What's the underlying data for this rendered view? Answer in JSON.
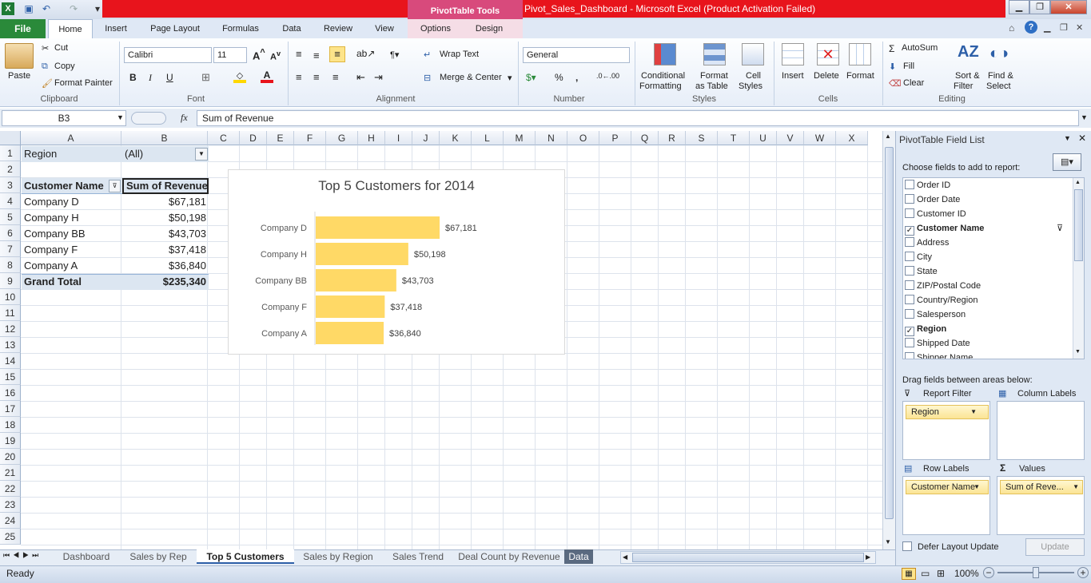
{
  "title": {
    "context_tab": "PivotTable Tools",
    "window_title": "Pivot_Sales_Dashboard - Microsoft Excel (Product Activation Failed)"
  },
  "tabs": [
    "File",
    "Home",
    "Insert",
    "Page Layout",
    "Formulas",
    "Data",
    "Review",
    "View",
    "Options",
    "Design"
  ],
  "ribbon": {
    "clipboard": {
      "paste": "Paste",
      "cut": "Cut",
      "copy": "Copy",
      "format_painter": "Format Painter",
      "label": "Clipboard"
    },
    "font": {
      "name": "Calibri",
      "size": "11",
      "label": "Font"
    },
    "alignment": {
      "wrap": "Wrap Text",
      "merge": "Merge & Center",
      "label": "Alignment"
    },
    "number": {
      "format": "General",
      "label": "Number"
    },
    "styles": {
      "conditional": "Conditional",
      "formatting": "Formatting",
      "format": "Format",
      "as_table": "as Table",
      "cell": "Cell",
      "cell_styles": "Styles",
      "label": "Styles"
    },
    "cells": {
      "insert": "Insert",
      "delete": "Delete",
      "format": "Format",
      "label": "Cells"
    },
    "editing": {
      "autosum": "AutoSum",
      "fill": "Fill",
      "clear": "Clear",
      "sort": "Sort &",
      "filter": "Filter",
      "find": "Find &",
      "select": "Select",
      "label": "Editing"
    }
  },
  "formula_bar": {
    "name_box": "B3",
    "fx": "fx",
    "content": "Sum of Revenue"
  },
  "columns": [
    "A",
    "B",
    "C",
    "D",
    "E",
    "F",
    "G",
    "H",
    "I",
    "J",
    "K",
    "L",
    "M",
    "N",
    "O",
    "P",
    "Q",
    "R",
    "S",
    "T",
    "U",
    "V",
    "W",
    "X"
  ],
  "rows": [
    "1",
    "2",
    "3",
    "4",
    "5",
    "6",
    "7",
    "8",
    "9",
    "10",
    "11",
    "12",
    "13",
    "14",
    "15",
    "16",
    "17",
    "18",
    "19",
    "20",
    "21",
    "22",
    "23",
    "24",
    "25"
  ],
  "pivot": {
    "filter_label": "Region",
    "filter_value": "(All)",
    "header_name": "Customer Name",
    "header_value": "Sum of Revenue",
    "rows": [
      {
        "name": "Company D",
        "value": "$67,181"
      },
      {
        "name": "Company H",
        "value": "$50,198"
      },
      {
        "name": "Company BB",
        "value": "$43,703"
      },
      {
        "name": "Company F",
        "value": "$37,418"
      },
      {
        "name": "Company A",
        "value": "$36,840"
      }
    ],
    "total_label": "Grand Total",
    "total_value": "$235,340"
  },
  "chart_data": {
    "type": "bar",
    "title": "Top 5 Customers for 2014",
    "categories": [
      "Company D",
      "Company H",
      "Company BB",
      "Company F",
      "Company A"
    ],
    "values": [
      67181,
      50198,
      43703,
      37418,
      36840
    ],
    "labels": [
      "$67,181",
      "$50,198",
      "$43,703",
      "$37,418",
      "$36,840"
    ],
    "xlim": [
      0,
      130000
    ],
    "orientation": "horizontal",
    "bar_color": "#ffd966",
    "grid": false
  },
  "sheets": [
    "Dashboard",
    "Sales by Rep",
    "Top 5 Customers",
    "Sales by Region",
    "Sales Trend",
    "Deal Count by Revenue",
    "Data"
  ],
  "active_sheet": "Top 5 Customers",
  "status": {
    "ready": "Ready",
    "zoom": "100%"
  },
  "field_list": {
    "title": "PivotTable Field List",
    "choose": "Choose fields to add to report:",
    "fields": [
      {
        "name": "Order ID",
        "checked": false
      },
      {
        "name": "Order Date",
        "checked": false
      },
      {
        "name": "Customer ID",
        "checked": false
      },
      {
        "name": "Customer Name",
        "checked": true
      },
      {
        "name": "Address",
        "checked": false
      },
      {
        "name": "City",
        "checked": false
      },
      {
        "name": "State",
        "checked": false
      },
      {
        "name": "ZIP/Postal Code",
        "checked": false
      },
      {
        "name": "Country/Region",
        "checked": false
      },
      {
        "name": "Salesperson",
        "checked": false
      },
      {
        "name": "Region",
        "checked": true
      },
      {
        "name": "Shipped Date",
        "checked": false
      },
      {
        "name": "Shipper Name",
        "checked": false
      }
    ],
    "drag_label": "Drag fields between areas below:",
    "report_filter": "Report Filter",
    "column_labels": "Column Labels",
    "row_labels": "Row Labels",
    "values": "Values",
    "filter_pill": "Region",
    "row_pill": "Customer Name",
    "values_pill": "Sum of Reve...",
    "defer": "Defer Layout Update",
    "update": "Update"
  }
}
